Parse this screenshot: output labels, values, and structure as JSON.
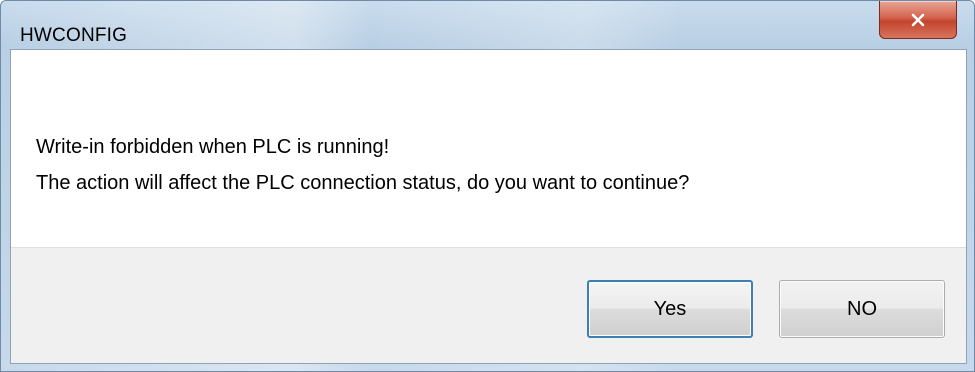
{
  "window": {
    "title": "HWCONFIG",
    "close_icon": "close-icon"
  },
  "message": {
    "line1": "Write-in forbidden when PLC is running!",
    "line2": "The action will affect the PLC connection status, do you want to continue?"
  },
  "buttons": {
    "yes_label": "Yes",
    "no_label": "NO"
  },
  "colors": {
    "title_bar": "#c7d9ea",
    "close_button": "#c4442d",
    "default_button_border": "#3c7fb1",
    "button_area": "#f0f0f0"
  }
}
